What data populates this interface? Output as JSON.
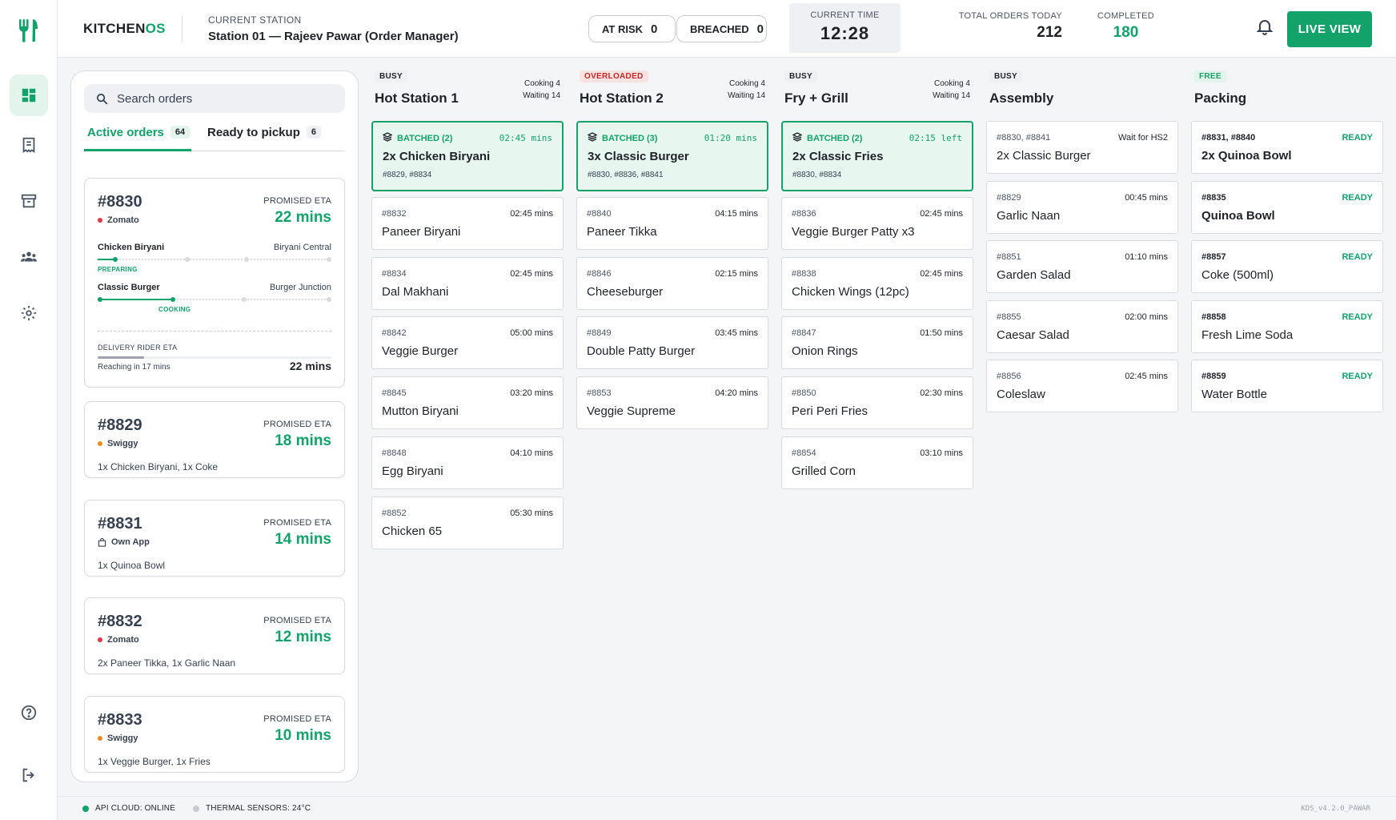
{
  "app": {
    "brand_main": "KITCHEN",
    "brand_accent": "OS"
  },
  "header": {
    "station_label": "CURRENT STATION",
    "station_name": "Station 01 — Rajeev Pawar (Order Manager)",
    "at_risk": {
      "label": "AT RISK",
      "value": "0"
    },
    "breached": {
      "label": "BREACHED",
      "value": "0"
    },
    "clock": {
      "label": "CURRENT TIME",
      "time": "12:28"
    },
    "total_orders": {
      "label": "TOTAL ORDERS TODAY",
      "value": "212"
    },
    "completed": {
      "label": "COMPLETED",
      "value": "180"
    },
    "live_button": "LIVE VIEW"
  },
  "sidebar": {
    "items": [
      {
        "icon": "dashboard-icon",
        "active": true
      },
      {
        "icon": "receipt-icon",
        "active": false
      },
      {
        "icon": "archive-icon",
        "active": false
      },
      {
        "icon": "team-icon",
        "active": false
      },
      {
        "icon": "settings-icon",
        "active": false
      }
    ],
    "bottom": [
      {
        "icon": "help-icon"
      },
      {
        "icon": "logout-icon"
      }
    ]
  },
  "orders": {
    "search_placeholder": "Search orders",
    "tabs": [
      {
        "label": "Active orders",
        "count": "64"
      },
      {
        "label": "Ready to pickup",
        "count": "6"
      }
    ],
    "expanded": {
      "id": "#8830",
      "source": "Zomato",
      "eta_label": "PROMISED ETA",
      "eta": "22 mins",
      "lines": [
        {
          "item": "Chicken Biryani",
          "vendor": "Biryani Central",
          "status": "PREPARING",
          "progress": 0.07
        },
        {
          "item": "Classic Burger",
          "vendor": "Burger Junction",
          "status": "COOKING",
          "progress": 0.32
        }
      ],
      "rider_label": "DELIVERY RIDER ETA",
      "rider_progress": 0.2,
      "rider_sub": "Reaching in 17 mins",
      "rider_eta": "22 mins"
    },
    "cards": [
      {
        "id": "#8829",
        "source": "Swiggy",
        "source_color": "#f08a24",
        "eta_label": "PROMISED ETA",
        "eta": "18 mins",
        "items": "1x Chicken Biryani, 1x Coke"
      },
      {
        "id": "#8831",
        "source": "Own App",
        "source_color": "",
        "eta_label": "PROMISED ETA",
        "eta": "14 mins",
        "items": "1x Quinoa Bowl"
      },
      {
        "id": "#8832",
        "source": "Zomato",
        "source_color": "#e23744",
        "eta_label": "PROMISED ETA",
        "eta": "12 mins",
        "items": "2x Paneer Tikka, 1x Garlic Naan"
      },
      {
        "id": "#8833",
        "source": "Swiggy",
        "source_color": "#f08a24",
        "eta_label": "PROMISED ETA",
        "eta": "10 mins",
        "items": "1x Veggie Burger, 1x Fries"
      }
    ]
  },
  "stations": [
    {
      "badge": "BUSY",
      "title": "Hot Station 1",
      "cooking": "Cooking 4",
      "waiting": "Waiting 14",
      "batch": {
        "label": "BATCHED (2)",
        "time": "02:45 mins",
        "name": "2x Chicken Biryani",
        "ids": "#8829, #8834"
      },
      "tickets": [
        {
          "id": "#8832",
          "time": "02:45 mins",
          "name": "Paneer Biryani"
        },
        {
          "id": "#8834",
          "time": "02:45 mins",
          "name": "Dal Makhani"
        },
        {
          "id": "#8842",
          "time": "05:00 mins",
          "name": "Veggie Burger"
        },
        {
          "id": "#8845",
          "time": "03:20 mins",
          "name": "Mutton Biryani"
        },
        {
          "id": "#8848",
          "time": "04:10 mins",
          "name": "Egg Biryani"
        },
        {
          "id": "#8852",
          "time": "05:30 mins",
          "name": "Chicken 65"
        }
      ]
    },
    {
      "badge": "OVERLOADED",
      "title": "Hot Station 2",
      "cooking": "Cooking 4",
      "waiting": "Waiting 14",
      "batch": {
        "label": "BATCHED (3)",
        "time": "01:20 mins",
        "name": "3x Classic Burger",
        "ids": "#8830, #8836, #8841"
      },
      "tickets": [
        {
          "id": "#8840",
          "time": "04:15 mins",
          "name": "Paneer Tikka"
        },
        {
          "id": "#8846",
          "time": "02:15 mins",
          "name": "Cheeseburger"
        },
        {
          "id": "#8849",
          "time": "03:45 mins",
          "name": "Double Patty Burger"
        },
        {
          "id": "#8853",
          "time": "04:20 mins",
          "name": "Veggie Supreme"
        }
      ]
    },
    {
      "badge": "BUSY",
      "title": "Fry + Grill",
      "cooking": "Cooking 4",
      "waiting": "Waiting 14",
      "batch": {
        "label": "BATCHED (2)",
        "time": "02:15 left",
        "name": "2x Classic Fries",
        "ids": "#8830, #8834"
      },
      "tickets": [
        {
          "id": "#8836",
          "time": "02:45 mins",
          "name": "Veggie Burger Patty x3"
        },
        {
          "id": "#8838",
          "time": "02:45 mins",
          "name": "Chicken Wings (12pc)"
        },
        {
          "id": "#8847",
          "time": "01:50 mins",
          "name": "Onion Rings"
        },
        {
          "id": "#8850",
          "time": "02:30 mins",
          "name": "Peri Peri Fries"
        },
        {
          "id": "#8854",
          "time": "03:10 mins",
          "name": "Grilled Corn"
        }
      ]
    },
    {
      "badge": "BUSY",
      "title": "Assembly",
      "tickets": [
        {
          "id": "#8830, #8841",
          "time": "Wait for HS2",
          "name": "2x Classic Burger"
        },
        {
          "id": "#8829",
          "time": "00:45 mins",
          "name": "Garlic Naan"
        },
        {
          "id": "#8851",
          "time": "01:10 mins",
          "name": "Garden Salad"
        },
        {
          "id": "#8855",
          "time": "02:00 mins",
          "name": "Caesar Salad"
        },
        {
          "id": "#8856",
          "time": "02:45 mins",
          "name": "Coleslaw"
        }
      ]
    },
    {
      "badge": "FREE",
      "title": "Packing",
      "tickets": [
        {
          "id": "#8831, #8840",
          "time": "READY",
          "name": "2x Quinoa Bowl"
        },
        {
          "id": "#8835",
          "time": "READY",
          "name": "Quinoa Bowl"
        },
        {
          "id": "#8857",
          "time": "READY",
          "name": "Coke (500ml)"
        },
        {
          "id": "#8858",
          "time": "READY",
          "name": "Fresh Lime Soda"
        },
        {
          "id": "#8859",
          "time": "READY",
          "name": "Water Bottle"
        }
      ]
    }
  ],
  "footer": {
    "api": "API CLOUD: ONLINE",
    "thermal": "THERMAL SENSORS: 24°C",
    "version": "KDS_v4.2.0_PAWAR"
  },
  "colors": {
    "accent": "#12a26a",
    "zomato": "#e23744",
    "swiggy": "#f08a24",
    "overloaded_bg": "#fde2e2",
    "overloaded_fg": "#c62828",
    "badge_bg": "#eef0f3",
    "free_bg": "#e3f4ec"
  }
}
